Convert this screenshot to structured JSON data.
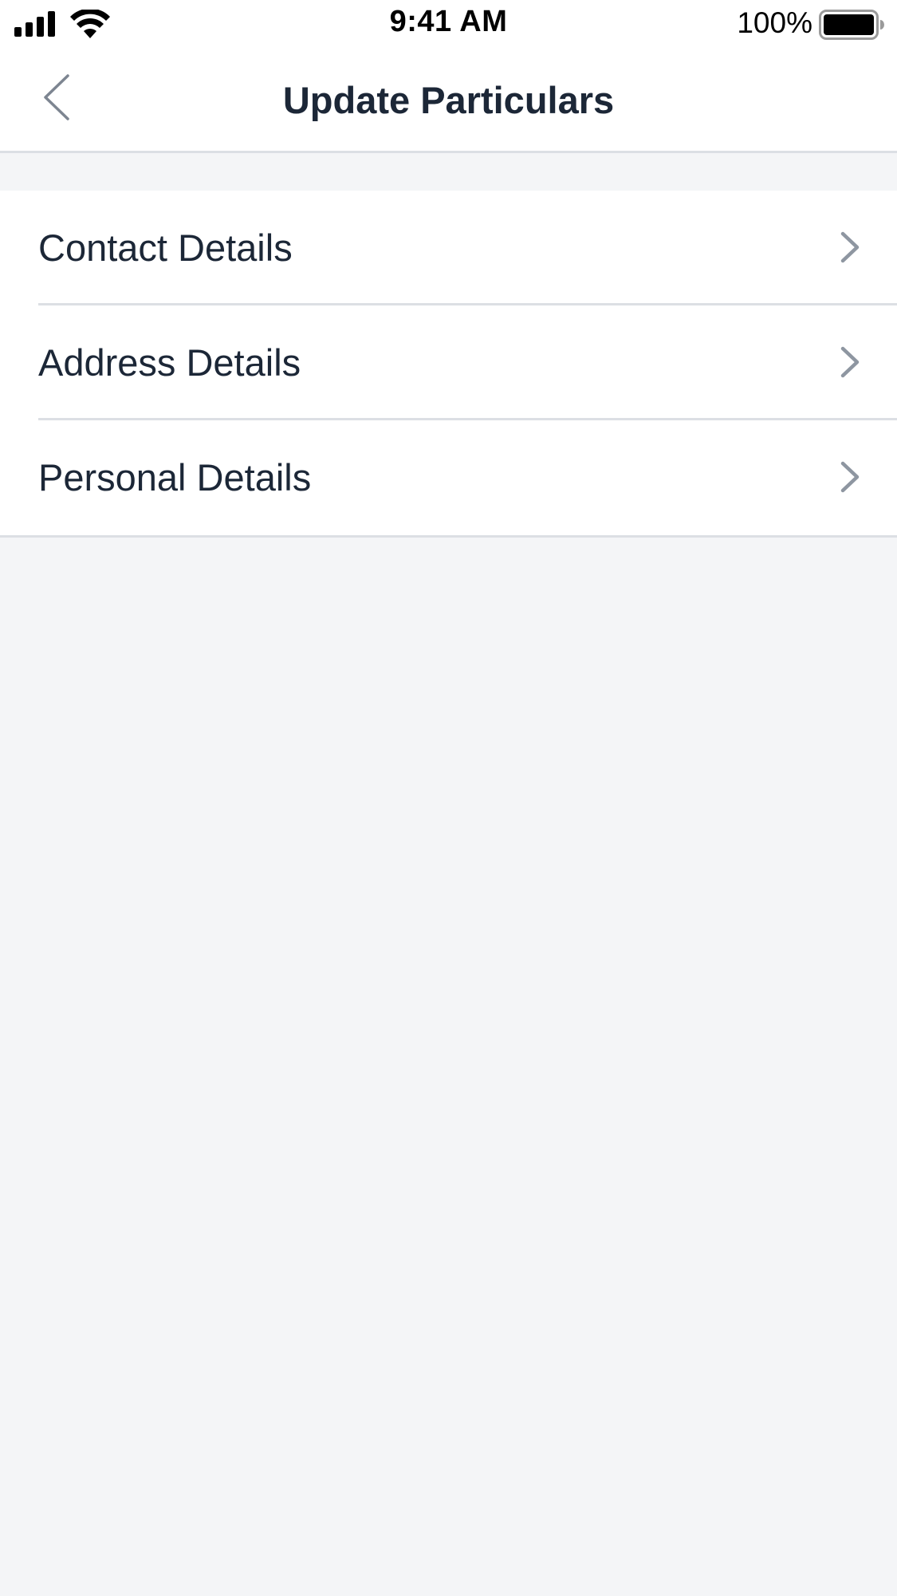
{
  "status_bar": {
    "time": "9:41 AM",
    "battery": "100%",
    "icons": [
      "signal-icon",
      "wifi-icon",
      "battery-icon"
    ]
  },
  "nav": {
    "title": "Update Particulars",
    "back_icon": "chevron-left-icon"
  },
  "list": {
    "items": [
      {
        "label": "Contact Details"
      },
      {
        "label": "Address Details"
      },
      {
        "label": "Personal Details"
      }
    ],
    "item_icon": "chevron-right-icon"
  },
  "colors": {
    "background": "#f4f5f7",
    "surface": "#ffffff",
    "text": "#1c2737",
    "divider": "#dcdfe4",
    "chevron": "#8e96a1"
  }
}
